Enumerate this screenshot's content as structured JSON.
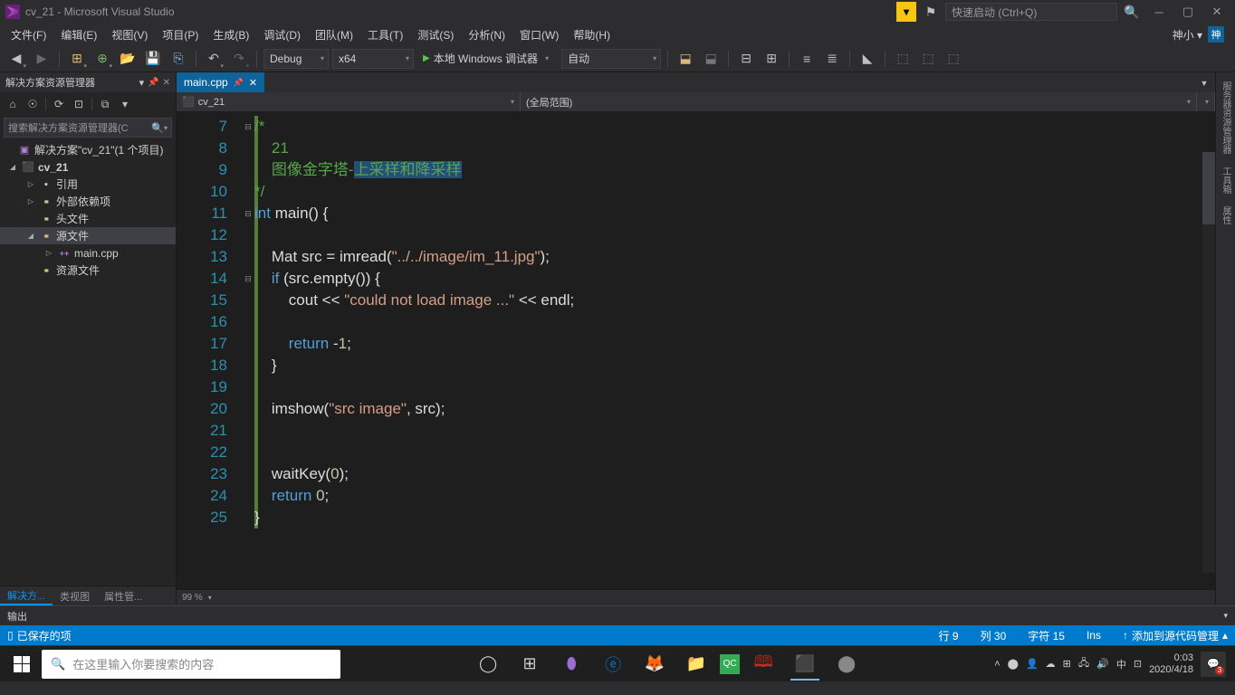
{
  "title": "cv_21 - Microsoft Visual Studio",
  "quick_launch_placeholder": "快速启动 (Ctrl+Q)",
  "menubar": [
    "文件(F)",
    "编辑(E)",
    "视图(V)",
    "项目(P)",
    "生成(B)",
    "调试(D)",
    "团队(M)",
    "工具(T)",
    "测试(S)",
    "分析(N)",
    "窗口(W)",
    "帮助(H)"
  ],
  "menubar_right_user": "神小 ▾",
  "menubar_right_badge": "神",
  "toolbar": {
    "config": "Debug",
    "platform": "x64",
    "run_label": "本地 Windows 调试器",
    "auto": "自动"
  },
  "side_panel": {
    "title": "解决方案资源管理器",
    "search_placeholder": "搜索解决方案资源管理器(C",
    "tree": {
      "solution": "解决方案\"cv_21\"(1 个项目)",
      "project": "cv_21",
      "refs": "引用",
      "ext": "外部依赖项",
      "headers": "头文件",
      "sources": "源文件",
      "maincpp": "main.cpp",
      "resources": "资源文件"
    },
    "tabs": [
      "解决方...",
      "类视图",
      "属性管..."
    ]
  },
  "editor": {
    "tab": "main.cpp",
    "nav_left": "cv_21",
    "nav_right": "(全局范围)",
    "zoom": "99 %",
    "first_line": 7,
    "lines": [
      {
        "t": "comment",
        "txt": "/*"
      },
      {
        "t": "comment",
        "txt": "    21"
      },
      {
        "t": "comment_sel",
        "pre": "    图像金字塔-",
        "sel": "上采样和降采样"
      },
      {
        "t": "comment",
        "txt": "*/"
      },
      {
        "t": "code",
        "html": "<span class='c-keyword'>int</span> main() {"
      },
      {
        "t": "blank"
      },
      {
        "t": "code",
        "html": "    Mat src = imread(<span class='c-str'>\"../../image/im_11.jpg\"</span>);"
      },
      {
        "t": "code",
        "html": "    <span class='c-keyword'>if</span> (src.empty()) {"
      },
      {
        "t": "code",
        "html": "        cout &lt;&lt; <span class='c-str'>\"could not load image ...\"</span> &lt;&lt; endl;"
      },
      {
        "t": "blank"
      },
      {
        "t": "code",
        "html": "        <span class='c-keyword'>return</span> -<span class='c-num'>1</span>;"
      },
      {
        "t": "code",
        "html": "    }"
      },
      {
        "t": "blank"
      },
      {
        "t": "code",
        "html": "    imshow(<span class='c-str'>\"src image\"</span>, src);"
      },
      {
        "t": "blank"
      },
      {
        "t": "blank"
      },
      {
        "t": "code",
        "html": "    waitKey(<span class='c-num'>0</span>);"
      },
      {
        "t": "code",
        "html": "    <span class='c-keyword'>return</span> <span class='c-num'>0</span>;"
      },
      {
        "t": "code",
        "html": "}"
      }
    ]
  },
  "right_tabs": [
    "服务器资源管理器",
    "工具箱",
    "属性"
  ],
  "output_title": "输出",
  "status": {
    "saved": "已保存的项",
    "line": "行 9",
    "col": "列 30",
    "char": "字符 15",
    "ins": "Ins",
    "scm": "添加到源代码管理"
  },
  "taskbar": {
    "search_placeholder": "在这里输入你要搜索的内容",
    "time": "0:03",
    "date": "2020/4/18",
    "ime": "中",
    "notif_count": "3"
  }
}
